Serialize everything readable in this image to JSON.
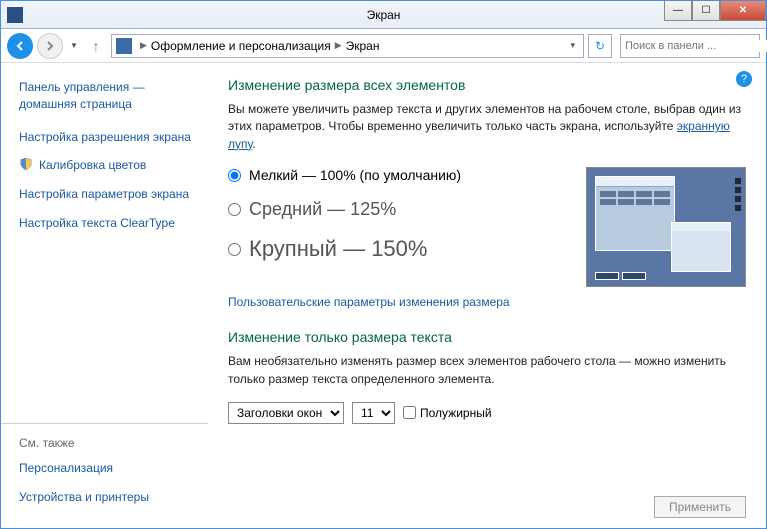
{
  "window": {
    "title": "Экран",
    "breadcrumb": {
      "cat": "Оформление и персонализация",
      "page": "Экран"
    },
    "search_placeholder": "Поиск в панели ..."
  },
  "sidebar": {
    "panel_home1": "Панель управления —",
    "panel_home2": "домашняя страница",
    "items": [
      {
        "label": "Настройка разрешения экрана",
        "shield": false
      },
      {
        "label": "Калибровка цветов",
        "shield": true
      },
      {
        "label": "Настройка параметров экрана",
        "shield": false
      },
      {
        "label": "Настройка текста ClearType",
        "shield": false
      }
    ],
    "seealso_head": "См. также",
    "seealso": [
      {
        "label": "Персонализация"
      },
      {
        "label": "Устройства и принтеры"
      }
    ]
  },
  "main": {
    "h1a": "Изменение размера всех элементов",
    "desc_a1": "Вы можете увеличить размер текста и других элементов на рабочем столе, выбрав один из этих параметров. Чтобы временно увеличить только часть экрана, используйте ",
    "desc_a_link": "экранную лупу",
    "desc_a2": ".",
    "radios": [
      {
        "label": "Мелкий — 100% (по умолчанию)",
        "checked": true
      },
      {
        "label": "Средний — 125%",
        "checked": false
      },
      {
        "label": "Крупный — 150%",
        "checked": false
      }
    ],
    "custom_link": "Пользовательские параметры изменения размера",
    "h1b": "Изменение только размера текста",
    "desc_b": "Вам необязательно изменять размер всех элементов рабочего стола — можно изменить только размер текста определенного элемента.",
    "element_select": "Заголовки окон",
    "size_select": "11",
    "bold_label": "Полужирный",
    "apply": "Применить"
  }
}
